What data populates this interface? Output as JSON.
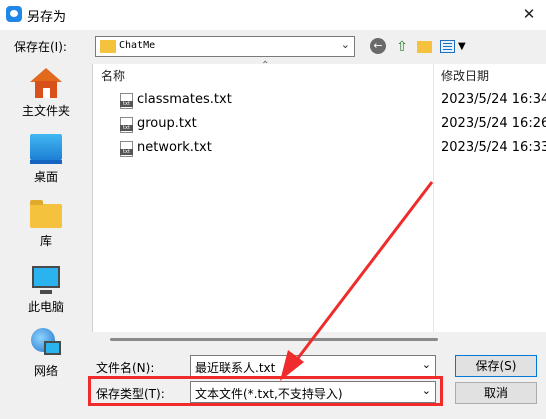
{
  "window": {
    "title": "另存为",
    "close_glyph": "✕"
  },
  "toolbar": {
    "save_in_label": "保存在(I):",
    "current_folder": "ChatMe",
    "back_icon": "back-arrow-icon",
    "up_icon": "up-folder-icon",
    "new_folder_icon": "new-folder-icon",
    "views_icon": "view-menu-icon"
  },
  "places": [
    {
      "label": "主文件夹",
      "icon": "home-icon"
    },
    {
      "label": "桌面",
      "icon": "desktop-icon"
    },
    {
      "label": "库",
      "icon": "library-icon"
    },
    {
      "label": "此电脑",
      "icon": "computer-icon"
    },
    {
      "label": "网络",
      "icon": "network-icon"
    }
  ],
  "file_list": {
    "columns": {
      "name": "名称",
      "date": "修改日期"
    },
    "rows": [
      {
        "name": "classmates.txt",
        "date": "2023/5/24 16:34"
      },
      {
        "name": "group.txt",
        "date": "2023/5/24 16:26"
      },
      {
        "name": "network.txt",
        "date": "2023/5/24 16:33"
      }
    ]
  },
  "form": {
    "filename_label": "文件名(N):",
    "filename_value": "最近联系人.txt",
    "type_label": "保存类型(T):",
    "type_value": "文本文件(*.txt,不支持导入)"
  },
  "buttons": {
    "save": "保存(S)",
    "cancel": "取消"
  },
  "annotation": {
    "highlight_color": "#ef2b2b"
  }
}
